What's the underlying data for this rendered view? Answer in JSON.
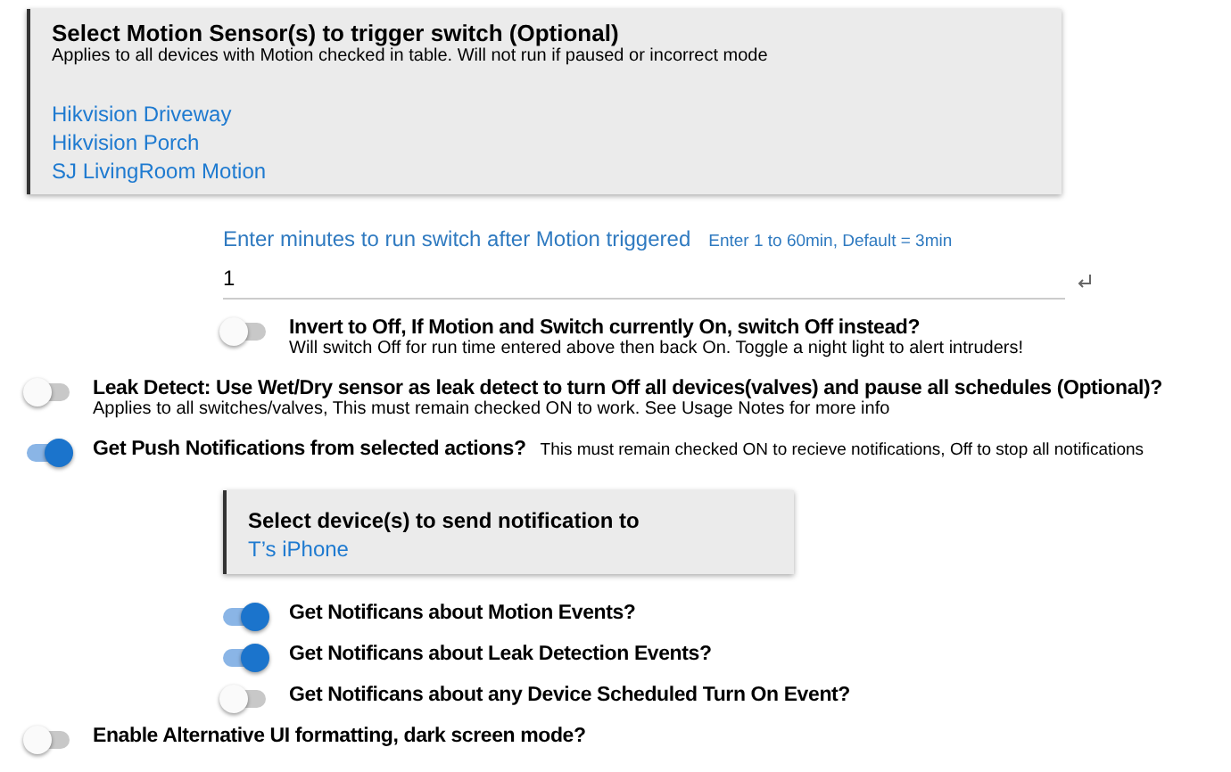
{
  "settings": [
    {
      "kind": "card",
      "title": "Select Motion Sensor(s) to trigger switch (Optional)",
      "subtitle": "Applies to all devices with Motion checked in table. Will not run if paused or incorrect mode",
      "devices": [
        "Hikvision Driveway",
        "Hikvision Porch",
        "SJ LivingRoom Motion"
      ],
      "children": [
        {
          "kind": "field",
          "label": "Enter minutes to run switch after Motion triggered",
          "hint": "Enter 1 to 60min, Default = 3min",
          "value": "1"
        },
        {
          "kind": "toggle",
          "on": false,
          "label": "Invert to Off, If Motion and Switch currently On, switch Off instead?",
          "note": "Will switch Off for run time entered above then back On. Toggle a night light to alert intruders!"
        }
      ]
    },
    {
      "kind": "toggle",
      "on": false,
      "label": "Leak Detect: Use Wet/Dry sensor as leak detect to turn Off all devices(valves) and pause all schedules (Optional)?",
      "note": "Applies to all switches/valves, This must remain checked ON to work. See Usage Notes for more info"
    },
    {
      "kind": "toggle",
      "on": true,
      "label": "Get Push Notifications from selected actions?",
      "inline_note": "This must remain checked ON to recieve notifications, Off to stop all notifications",
      "children": [
        {
          "kind": "card",
          "title": "Select device(s) to send notification to",
          "devices": [
            "T’s iPhone"
          ]
        },
        {
          "kind": "toggle",
          "on": true,
          "label": "Get Notificans about Motion Events?"
        },
        {
          "kind": "toggle",
          "on": true,
          "label": "Get Notificans about Leak Detection Events?"
        },
        {
          "kind": "toggle",
          "on": false,
          "label": "Get Notificans about any Device Scheduled Turn On Event?"
        }
      ]
    },
    {
      "kind": "toggle",
      "on": false,
      "label": "Enable Alternative UI formatting, dark screen mode?"
    }
  ]
}
